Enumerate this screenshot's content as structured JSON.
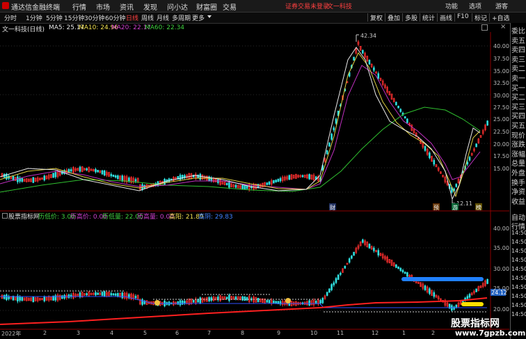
{
  "app": {
    "title": "通达信金融终端",
    "menu": [
      "行情",
      "市场",
      "资讯",
      "发现",
      "问小达",
      "财富圈",
      "交易"
    ],
    "alert": "证券交易未登录",
    "stock_name": "文一科技",
    "right_items": [
      "功能",
      "选项",
      "游客"
    ]
  },
  "periods": [
    "分时",
    "1分钟",
    "5分钟",
    "15分钟",
    "30分钟",
    "60分钟",
    "日线",
    "周线",
    "月线",
    "多周期",
    "更多"
  ],
  "active_period": "日线",
  "tools": [
    "复权",
    "叠加",
    "多股",
    "统计",
    "画线",
    "F10",
    "标记",
    "+自选"
  ],
  "main_info": {
    "name": "文一科技(日线)",
    "ma": [
      {
        "label": "MA5: 25.17",
        "color": "#e8e8e8"
      },
      {
        "label": "MA10: 24.96",
        "color": "#f0e050"
      },
      {
        "label": "MA20: 22.17",
        "color": "#d040d0"
      },
      {
        "label": "MA60: 22.34",
        "color": "#40d040"
      }
    ]
  },
  "sub_info": {
    "name": "股票指标网",
    "items": [
      {
        "label": "历低价: 3.00",
        "color": "#40d040"
      },
      {
        "label": "历高价: 0.00",
        "color": "#d040d0"
      },
      {
        "label": "历低量: 22.00",
        "color": "#40d040"
      },
      {
        "label": "历高量: 0.00",
        "color": "#d040d0"
      },
      {
        "label": "高阳: 21.89",
        "color": "#f0e050"
      },
      {
        "label": "高阴: 29.83",
        "color": "#4080ff"
      }
    ]
  },
  "main_axis": [
    "40.00",
    "37.50",
    "35.00",
    "32.50",
    "30.00",
    "27.50",
    "25.00",
    "22.50",
    "20.00",
    "17.50",
    "15.00"
  ],
  "sub_axis": [
    "40.00",
    "35.00",
    "30.00",
    "25.00",
    "20.00"
  ],
  "price_tag": "24.12",
  "annotations": {
    "high": "42.34",
    "low": "12.11"
  },
  "markers": [
    "财",
    "预",
    "游",
    "榜"
  ],
  "dates": [
    "2022年",
    "2",
    "3",
    "4",
    "5",
    "6",
    "7",
    "8",
    "9",
    "10",
    "11",
    "12",
    "1",
    "2"
  ],
  "right_panel": [
    "委比",
    "卖五",
    "卖四",
    "卖三",
    "卖二",
    "卖一",
    "买一",
    "买二",
    "买三",
    "买四",
    "买五",
    "现价",
    "涨跌",
    "涨幅",
    "总量",
    "外盘",
    "换手",
    "净资",
    "收益"
  ],
  "right_panel_sub": [
    "自动",
    "行情",
    "14:50",
    "14:50",
    "14:50",
    "14:50",
    "14:50",
    "14:50",
    "14:50",
    "14:50",
    "14:50",
    "14:50"
  ],
  "watermark": {
    "line1": "股票指标网",
    "line2": "www.7gpzb.com"
  }
}
